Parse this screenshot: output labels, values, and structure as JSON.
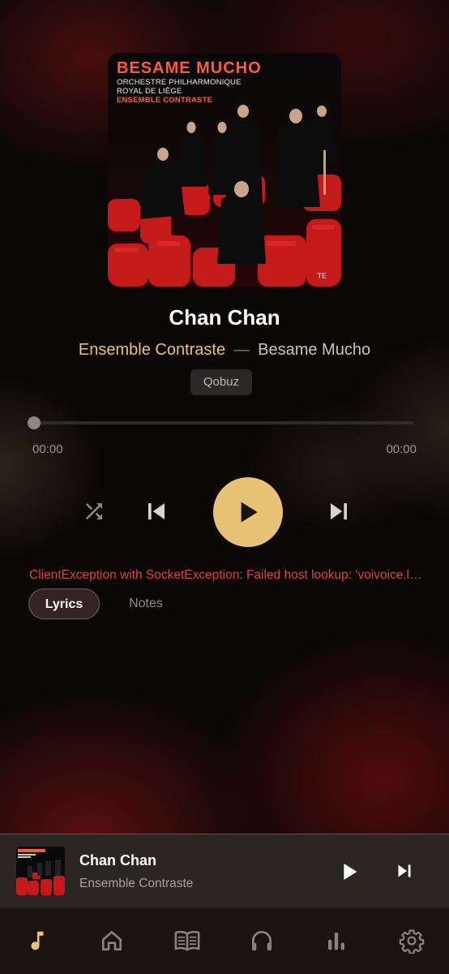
{
  "now_playing": {
    "cover": {
      "title": "BESAME MUCHO",
      "line1": "ORCHESTRE PHILHARMONIQUE",
      "line2": "ROYAL DE LIÈGE",
      "line3": "ENSEMBLE CONTRASTE",
      "label_mark": "TE"
    },
    "title": "Chan Chan",
    "artist": "Ensemble Contraste",
    "separator": "—",
    "album": "Besame Mucho",
    "source": "Qobuz",
    "progress": 0,
    "time_elapsed": "00:00",
    "time_total": "00:00",
    "error_message": "ClientException with SocketException: Failed host lookup: 'voivoice.lrc.kuwo.cn' (OS Error: No address associated with hostname, errno = 7), uri=http://voivoice.lrc.kuwo.cn",
    "tabs": [
      {
        "label": "Lyrics",
        "active": true
      },
      {
        "label": "Notes",
        "active": false
      }
    ]
  },
  "mini_player": {
    "title": "Chan Chan",
    "artist": "Ensemble Contraste"
  },
  "nav": {
    "items": [
      {
        "icon": "music-note-icon",
        "active": true
      },
      {
        "icon": "home-icon",
        "active": false
      },
      {
        "icon": "library-book-icon",
        "active": false
      },
      {
        "icon": "headphones-icon",
        "active": false
      },
      {
        "icon": "equalizer-icon",
        "active": false
      },
      {
        "icon": "settings-gear-icon",
        "active": false
      }
    ]
  },
  "colors": {
    "accent": "#e8c275",
    "error": "#e0413a",
    "mini_player_bg": "#2c2622",
    "nav_bg": "#1a1512"
  }
}
